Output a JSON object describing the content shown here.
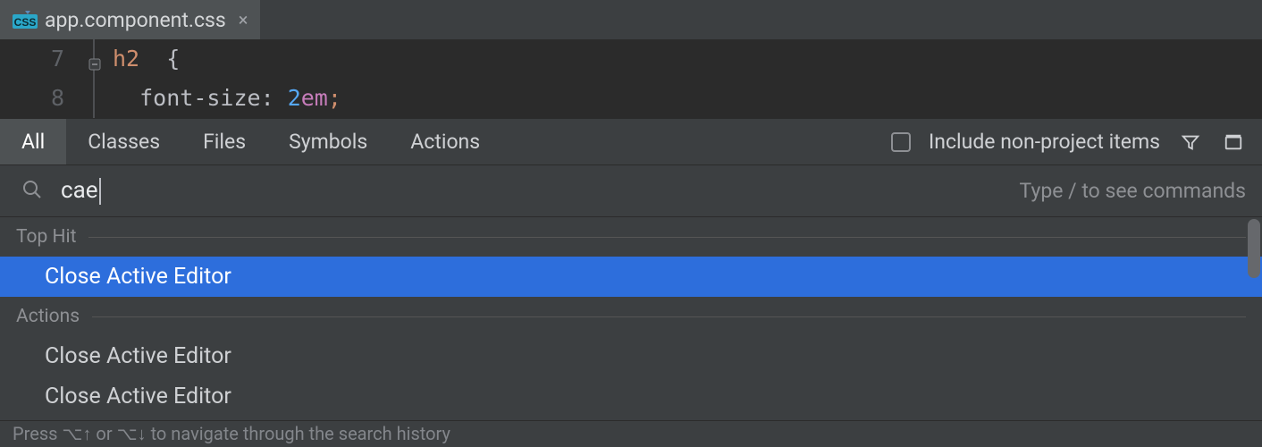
{
  "file_tab": {
    "icon": "css",
    "label": "app.component.css"
  },
  "editor": {
    "lines": [
      {
        "num": "7",
        "indent": 0,
        "selector": "h2",
        "open_brace": "{"
      },
      {
        "num": "8",
        "indent": 1,
        "prop": "font-size",
        "value_num": "2",
        "value_unit": "em"
      }
    ]
  },
  "search_everywhere": {
    "tabs": [
      "All",
      "Classes",
      "Files",
      "Symbols",
      "Actions"
    ],
    "active_tab": "All",
    "include_non_project": {
      "checked": false,
      "label": "Include non-project items"
    },
    "query": "cae",
    "hint": "Type / to see commands",
    "sections": [
      {
        "title": "Top Hit",
        "items": [
          "Close Active Editor"
        ],
        "selected_index": 0
      },
      {
        "title": "Actions",
        "items": [
          "Close Active Editor",
          "Close Active Editor"
        ],
        "selected_index": -1
      }
    ],
    "footer": "Press ⌥↑ or ⌥↓ to navigate through the search history"
  }
}
